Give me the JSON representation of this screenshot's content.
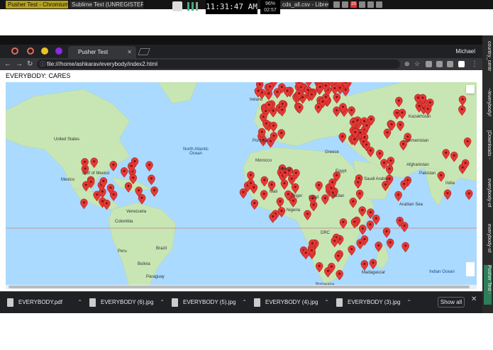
{
  "os_taskbar": {
    "tasks": [
      "Pusher Test - Chromium",
      "Sublime Text (UNREGISTERED)",
      "cds_all.csv - LibreO"
    ],
    "clock": "11:31:47 AM",
    "battery_percent": "96%",
    "battery_time": "02:57",
    "volume_badge": "25"
  },
  "browser": {
    "tab_title": "Pusher Test",
    "profile_name": "Michael",
    "url": "file:///home/ashkarav/everybody/index2.html"
  },
  "page": {
    "heading": "EVERYBODY: CARES"
  },
  "map": {
    "ocean_labels": [
      "North Atlantic Ocean",
      "Indian Ocean"
    ],
    "country_labels": [
      "Ireland",
      "Kazakhstan",
      "United States",
      "Portugal",
      "Turkmenistan",
      "Morocco",
      "Algeria",
      "Egypt",
      "Mexico",
      "Saudi Arabia",
      "Afghanistan",
      "Pakistan",
      "Mali",
      "Niger",
      "Chad",
      "Sudan",
      "Venezuela",
      "Nigeria",
      "Colombia",
      "DRC",
      "Peru",
      "Brazil",
      "Bolivia",
      "Paraguay",
      "Madagascar",
      "Botswana",
      "Greece",
      "India",
      "Gulf of Mexico",
      "Arabian Sea"
    ],
    "colors": {
      "water": "#aadaff",
      "land": "#c8e6b4",
      "marker": "#e53935",
      "equator": "#c47e7e"
    },
    "marker_count": 240
  },
  "downloads": {
    "items": [
      "EVERYBODY.pdf",
      "EVERYBODY (6).jpg",
      "EVERYBODY (5).jpg",
      "EVERYBODY (4).jpg",
      "EVERYBODY (3).jpg"
    ],
    "show_all_label": "Show all"
  },
  "side_panel": {
    "items": [
      "country_centr",
      "~/everybody/",
      "[Downloads -",
      "everybody-of",
      "everybody-of",
      "Pusher Test -"
    ]
  }
}
